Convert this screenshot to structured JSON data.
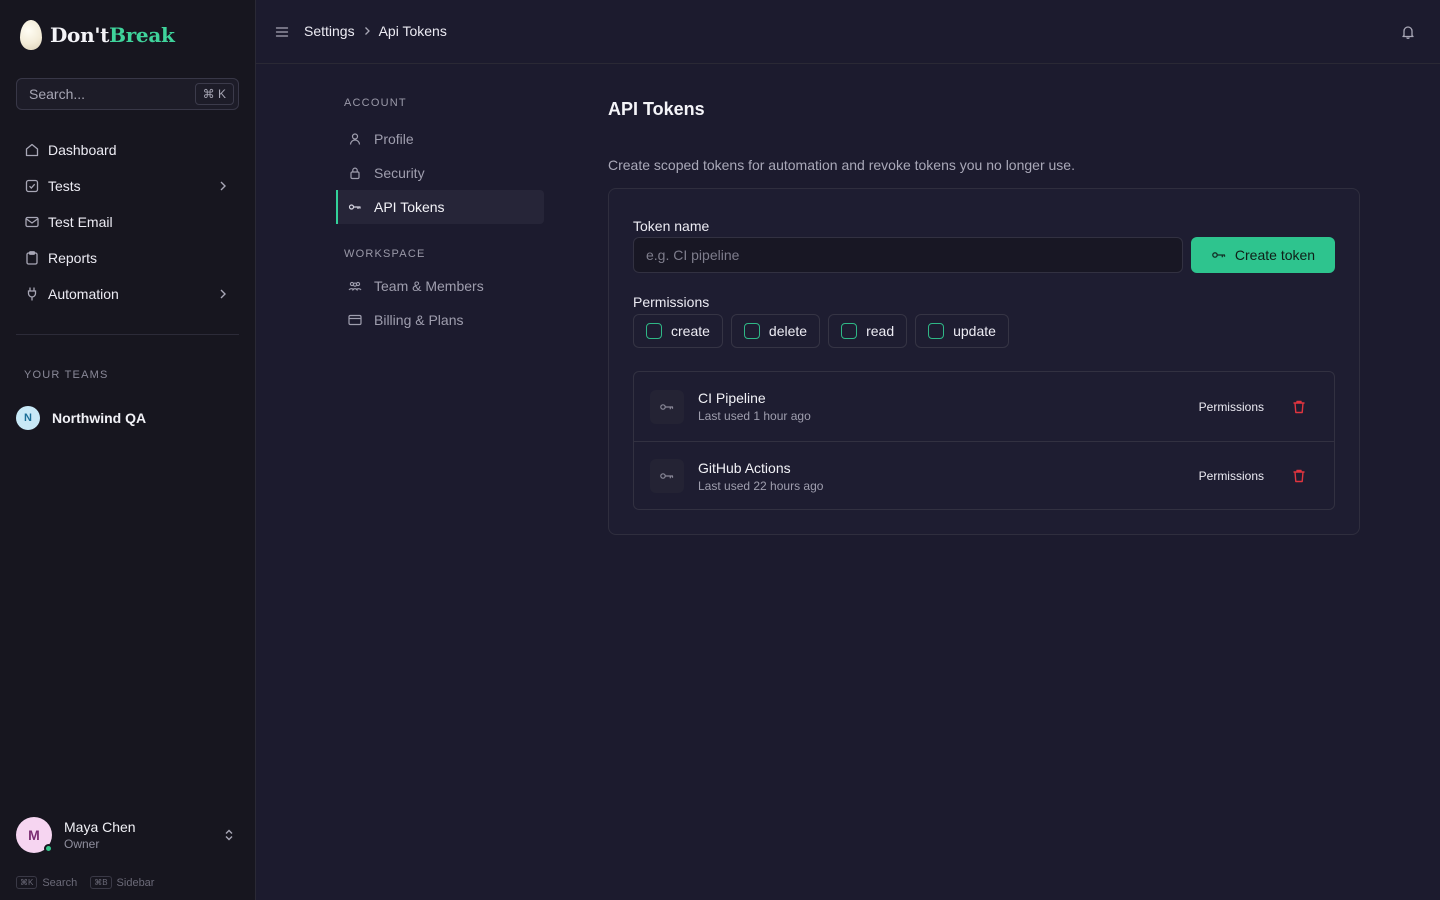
{
  "brand": {
    "name_part1": "Don't",
    "name_part2": "Break",
    "accent": "#3fd39b"
  },
  "search": {
    "placeholder": "Search...",
    "shortcut": "⌘ K"
  },
  "sidebar": {
    "items": [
      {
        "label": "Dashboard",
        "icon": "home-icon"
      },
      {
        "label": "Tests",
        "icon": "check-square-icon",
        "has_submenu": true
      },
      {
        "label": "Test Email",
        "icon": "mail-icon"
      },
      {
        "label": "Reports",
        "icon": "clipboard-icon"
      },
      {
        "label": "Automation",
        "icon": "plug-icon",
        "has_submenu": true
      }
    ],
    "teams_heading": "YOUR TEAMS",
    "team": {
      "initial": "N",
      "name": "Northwind QA"
    }
  },
  "user": {
    "initial": "M",
    "name": "Maya Chen",
    "role": "Owner",
    "status": "online"
  },
  "shortcuts": [
    {
      "keys": "⌘K",
      "label": "Search"
    },
    {
      "keys": "⌘B",
      "label": "Sidebar"
    }
  ],
  "breadcrumb": {
    "parent": "Settings",
    "current": "Api Tokens"
  },
  "settings_nav": {
    "account_heading": "ACCOUNT",
    "account_items": [
      {
        "label": "Profile",
        "icon": "user-icon"
      },
      {
        "label": "Security",
        "icon": "lock-icon"
      },
      {
        "label": "API Tokens",
        "icon": "key-icon",
        "active": true
      }
    ],
    "workspace_heading": "WORKSPACE",
    "workspace_items": [
      {
        "label": "Team & Members",
        "icon": "users-icon"
      },
      {
        "label": "Billing & Plans",
        "icon": "credit-card-icon"
      }
    ]
  },
  "page": {
    "title": "API Tokens",
    "description": "Create scoped tokens for automation and revoke tokens you no longer use."
  },
  "form": {
    "token_name_label": "Token name",
    "token_name_placeholder": "e.g. CI pipeline",
    "token_name_value": "",
    "create_button": "Create token",
    "permissions_label": "Permissions",
    "permissions": [
      {
        "label": "create",
        "checked": false
      },
      {
        "label": "delete",
        "checked": false
      },
      {
        "label": "read",
        "checked": false
      },
      {
        "label": "update",
        "checked": false
      }
    ]
  },
  "tokens": [
    {
      "name": "CI Pipeline",
      "last_used": "Last used 1 hour ago",
      "permissions_label": "Permissions"
    },
    {
      "name": "GitHub Actions",
      "last_used": "Last used 22 hours ago",
      "permissions_label": "Permissions"
    }
  ],
  "colors": {
    "primary": "#2ec48e",
    "danger": "#e0353f",
    "background": "#1c1b2e",
    "sidebar": "#17161f"
  }
}
